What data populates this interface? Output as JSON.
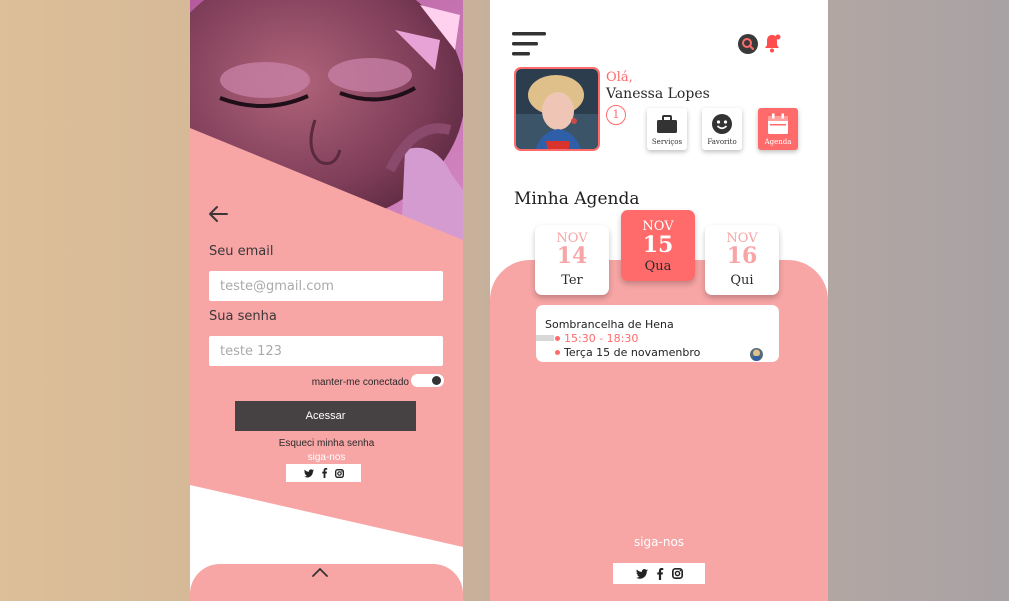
{
  "login": {
    "email_label": "Seu email",
    "email_placeholder": "teste@gmail.com",
    "password_label": "Sua senha",
    "password_placeholder": "teste 123",
    "remember_label": "manter-me conectado",
    "remember_on": true,
    "access_button": "Acessar",
    "forgot_link": "Esqueci minha senha",
    "follow_label": "siga-nos",
    "social": [
      "twitter",
      "facebook",
      "instagram"
    ]
  },
  "agenda": {
    "greeting": "Olá,",
    "user_name": "Vanessa Lopes",
    "notification_count": "1",
    "quick_actions": [
      {
        "label": "Serviços",
        "icon": "briefcase-icon",
        "active": false
      },
      {
        "label": "Favorito",
        "icon": "smiley-icon",
        "active": false
      },
      {
        "label": "Agenda",
        "icon": "calendar-icon",
        "active": true
      }
    ],
    "section_title": "Minha Agenda",
    "days": [
      {
        "month": "NOV",
        "day": "14",
        "weekday": "Ter",
        "selected": false
      },
      {
        "month": "NOV",
        "day": "15",
        "weekday": "Qua",
        "selected": true
      },
      {
        "month": "NOV",
        "day": "16",
        "weekday": "Qui",
        "selected": false
      }
    ],
    "event": {
      "title": "Sombrancelha de Hena",
      "time": "15:30 - 18:30",
      "date": "Terça 15 de novamenbro"
    },
    "follow_label": "siga-nos",
    "social": [
      "twitter",
      "facebook",
      "instagram"
    ]
  },
  "colors": {
    "pink": "#f7a5a5",
    "coral": "#ff6b6b",
    "dark": "#464243"
  }
}
